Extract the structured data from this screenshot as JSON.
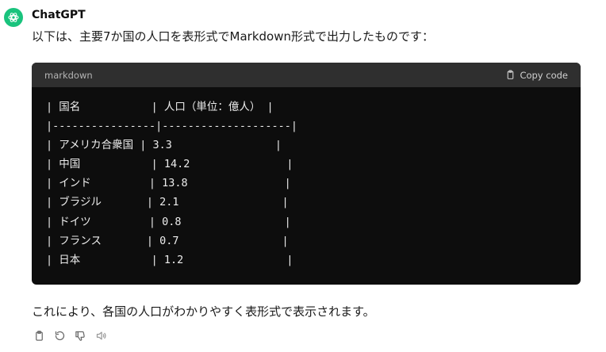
{
  "message": {
    "author": "ChatGPT",
    "intro": "以下は、主要7か国の人口を表形式でMarkdown形式で出力したものです：",
    "outro": "これにより、各国の人口がわかりやすく表形式で表示されます。"
  },
  "code_block": {
    "language": "markdown",
    "copy_label": "Copy code",
    "lines": [
      "| 国名           | 人口（単位：億人） |",
      "|----------------|--------------------|",
      "| アメリカ合衆国 | 3.3                |",
      "| 中国           | 14.2               |",
      "| インド         | 13.8               |",
      "| ブラジル       | 2.1                |",
      "| ドイツ         | 0.8                |",
      "| フランス       | 0.7                |",
      "| 日本           | 1.2                |"
    ]
  },
  "actions": [
    {
      "name": "copy-icon"
    },
    {
      "name": "regenerate-icon"
    },
    {
      "name": "thumbs-down-icon"
    },
    {
      "name": "speaker-icon"
    }
  ],
  "colors": {
    "avatar": "#19c37d",
    "code_background": "#0d0d0d",
    "code_header": "#2f2f2f"
  }
}
